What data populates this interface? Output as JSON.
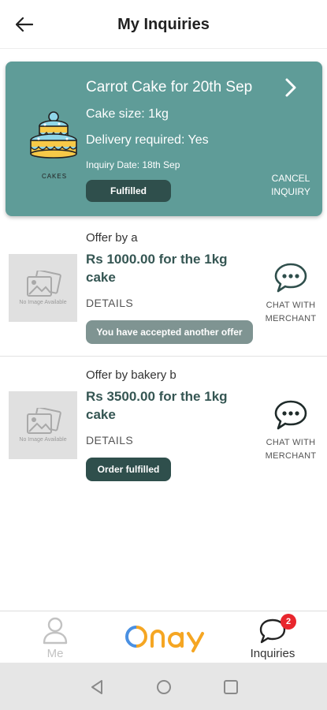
{
  "header": {
    "title": "My Inquiries",
    "back_icon": "arrow-left-icon"
  },
  "inquiry": {
    "title": "Carrot Cake for 20th Sep",
    "cake_size": "Cake size: 1kg",
    "delivery": "Delivery required: Yes",
    "date": "Inquiry Date: 18th Sep",
    "status": "Fulfilled",
    "cancel_line1": "CANCEL",
    "cancel_line2": "INQUIRY",
    "icon_caption": "CAKES",
    "card_color": "#5f9c98"
  },
  "offers": [
    {
      "offer_by": "Offer by a",
      "price": "Rs 1000.00 for the 1kg cake",
      "details": "DETAILS",
      "status": "You have accepted another offer",
      "no_image": "No Image Available",
      "chat_line1": "CHAT WITH",
      "chat_line2": "MERCHANT"
    },
    {
      "offer_by": "Offer by bakery b",
      "price": "Rs 3500.00 for the 1kg cake",
      "details": "DETAILS",
      "status": "Order fulfilled",
      "no_image": "No Image Available",
      "chat_line1": "CHAT WITH",
      "chat_line2": "MERCHANT"
    }
  ],
  "bottom_nav": {
    "me_label": "Me",
    "logo_text": "onay",
    "inquiries_label": "Inquiries",
    "inquiries_badge": "2",
    "accent_orange": "#f5a623",
    "accent_blue": "#4a90e2"
  },
  "colors": {
    "dark_badge": "#2f4f4c",
    "grey_badge": "#7f9492",
    "price_text": "#355653",
    "notification": "#e8262d"
  }
}
